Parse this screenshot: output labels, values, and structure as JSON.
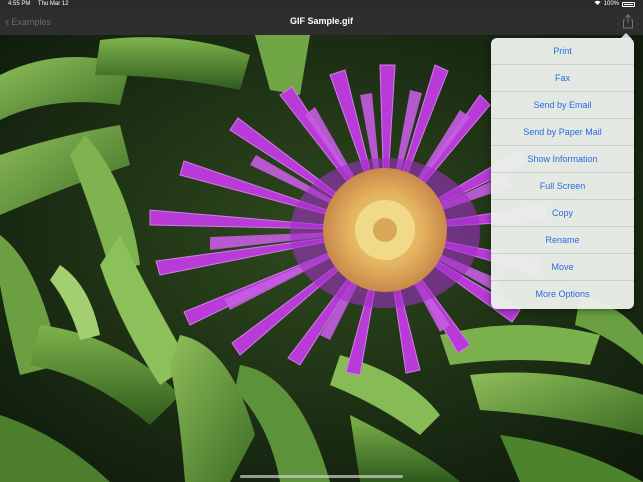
{
  "status": {
    "time": "4:55 PM",
    "date": "Thu Mar 12",
    "battery": "100%"
  },
  "nav": {
    "back_label": "Examples",
    "title": "GIF Sample.gif"
  },
  "icons": {
    "back": "chevron-left-icon",
    "share": "share-icon",
    "wifi": "wifi-icon",
    "battery": "battery-icon"
  },
  "menu": {
    "items": [
      {
        "label": "Print"
      },
      {
        "label": "Fax"
      },
      {
        "label": "Send by Email"
      },
      {
        "label": "Send by Paper Mail"
      },
      {
        "label": "Show Information"
      },
      {
        "label": "Full Screen"
      },
      {
        "label": "Copy"
      },
      {
        "label": "Rename"
      },
      {
        "label": "Move"
      },
      {
        "label": "More Options"
      }
    ]
  },
  "colors": {
    "menu_text": "#2a6ae0",
    "flower": "#b23ad6",
    "flower_center": "#e7c36a",
    "foliage": "#4f8a2f"
  }
}
